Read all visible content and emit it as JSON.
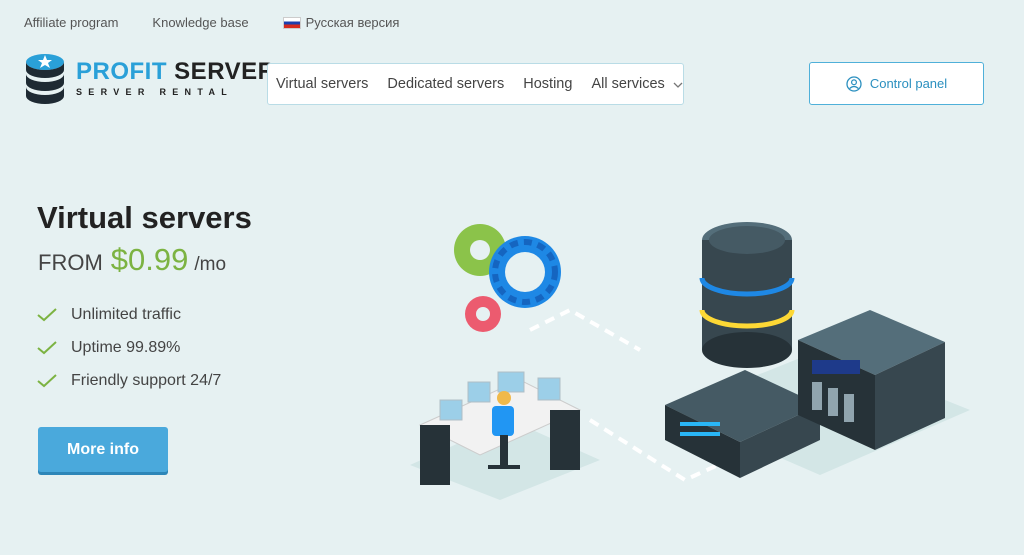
{
  "toplinks": {
    "affiliate": "Affiliate program",
    "knowledge": "Knowledge base",
    "russian": "Русская версия"
  },
  "logo": {
    "title_part1": "PROFIT",
    "title_part2": "SERVER",
    "subtitle": "SERVER RENTAL"
  },
  "nav": {
    "items": [
      "Virtual servers",
      "Dedicated servers",
      "Hosting",
      "All services"
    ]
  },
  "control_panel": {
    "label": "Control panel"
  },
  "hero": {
    "title": "Virtual servers",
    "price_prefix": "FROM",
    "price_amount": "$0.99",
    "price_unit": "/mo",
    "features": [
      "Unlimited traffic",
      "Uptime 99.89%",
      "Friendly support 24/7"
    ],
    "button": "More info"
  },
  "colors": {
    "accent": "#4aa9dc",
    "price_green": "#7cb342",
    "background": "#e6f1f2"
  }
}
